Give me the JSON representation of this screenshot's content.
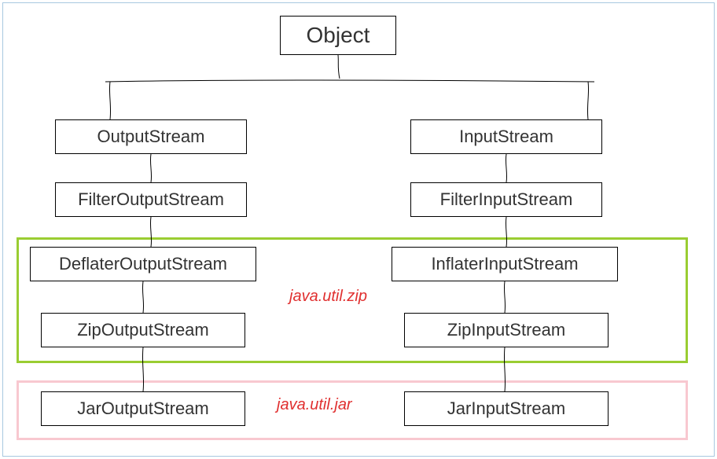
{
  "diagram": {
    "root": {
      "label": "Object"
    },
    "left_branch": {
      "l1": "OutputStream",
      "l2": "FilterOutputStream",
      "l3": "DeflaterOutputStream",
      "l4": "ZipOutputStream",
      "l5": "JarOutputStream"
    },
    "right_branch": {
      "r1": "InputStream",
      "r2": "FilterInputStream",
      "r3": "InflaterInputStream",
      "r4": "ZipInputStream",
      "r5": "JarInputStream"
    },
    "packages": {
      "zip": "java.util.zip",
      "jar": "java.util.jar"
    }
  }
}
